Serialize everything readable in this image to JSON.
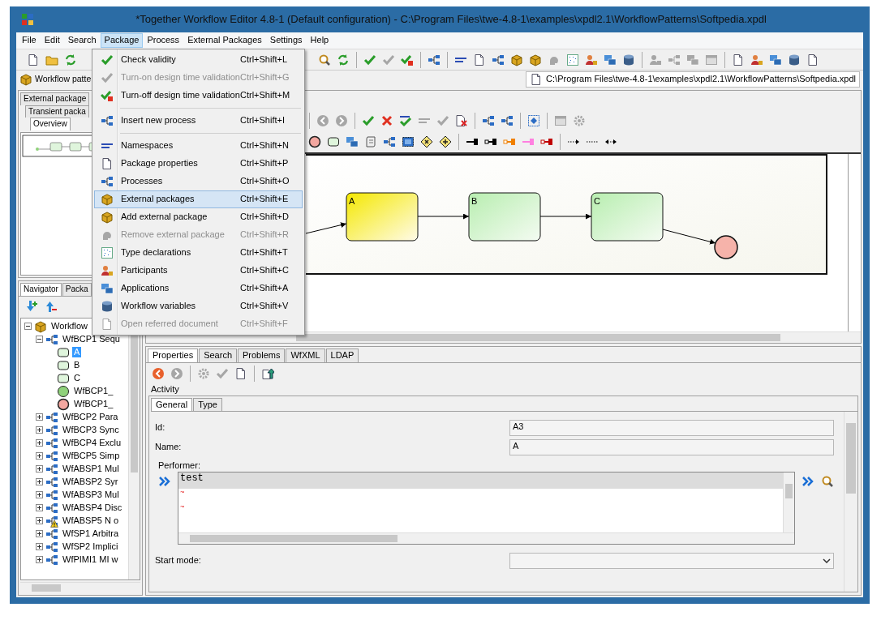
{
  "window": {
    "title": "*Together Workflow Editor 4.8-1 (Default configuration) - C:\\Program Files\\twe-4.8-1\\examples\\xpdl2.1\\WorkflowPatterns\\Softpedia.xpdl"
  },
  "menu_bar": [
    {
      "label": "File",
      "selected": false
    },
    {
      "label": "Edit",
      "selected": false
    },
    {
      "label": "Search",
      "selected": false
    },
    {
      "label": "Package",
      "selected": true
    },
    {
      "label": "Process",
      "selected": false
    },
    {
      "label": "External Packages",
      "selected": false
    },
    {
      "label": "Settings",
      "selected": false
    },
    {
      "label": "Help",
      "selected": false
    }
  ],
  "toolbar": [
    [
      {
        "kind": "doc",
        "disabled": false
      },
      {
        "kind": "folder",
        "disabled": false
      },
      {
        "kind": "sync",
        "disabled": false
      }
    ],
    [
      {
        "kind": "search",
        "disabled": false
      },
      {
        "kind": "sync",
        "disabled": false
      },
      {
        "kind": "separator"
      },
      {
        "kind": "check",
        "disabled": false
      },
      {
        "kind": "check",
        "disabled": true
      },
      {
        "kind": "checkred",
        "disabled": false
      },
      {
        "kind": "separator"
      },
      {
        "kind": "flow",
        "disabled": false
      },
      {
        "kind": "separator"
      },
      {
        "kind": "lines",
        "disabled": false
      },
      {
        "kind": "doc",
        "disabled": false
      },
      {
        "kind": "flow",
        "disabled": false
      },
      {
        "kind": "box",
        "disabled": false
      },
      {
        "kind": "box",
        "disabled": false
      },
      {
        "kind": "head",
        "disabled": true
      },
      {
        "kind": "grid",
        "disabled": false
      },
      {
        "kind": "person",
        "disabled": false
      },
      {
        "kind": "computer",
        "disabled": false
      },
      {
        "kind": "database",
        "disabled": false
      },
      {
        "kind": "separator"
      },
      {
        "kind": "person",
        "disabled": true
      },
      {
        "kind": "flow",
        "disabled": true
      },
      {
        "kind": "computer",
        "disabled": true
      },
      {
        "kind": "window",
        "disabled": true
      },
      {
        "kind": "separator"
      },
      {
        "kind": "doc",
        "disabled": false
      },
      {
        "kind": "person",
        "disabled": false
      },
      {
        "kind": "computer",
        "disabled": false
      },
      {
        "kind": "database",
        "disabled": false
      },
      {
        "kind": "doc",
        "disabled": false
      }
    ]
  ],
  "package_selector": {
    "value": "Workflow patte"
  },
  "file_path": "C:\\Program Files\\twe-4.8-1\\examples\\xpdl2.1\\WorkflowPatterns\\Softpedia.xpdl",
  "left_top_tabs": [
    {
      "label": "External package",
      "selected": false
    },
    {
      "label": "Transient packa",
      "selected": false
    },
    {
      "label": "Overview",
      "selected": true
    }
  ],
  "navigator_tabs": [
    {
      "label": "Navigator",
      "selected": true
    },
    {
      "label": "Packa",
      "selected": false
    }
  ],
  "tree": {
    "label": "Workflow",
    "kind": "package",
    "expanded": true,
    "selected": false,
    "children": [
      {
        "label": "WfBCP1 Sequ",
        "kind": "process",
        "expanded": true,
        "selected": false,
        "warning": false,
        "children": [
          {
            "label": "A",
            "kind": "activity",
            "selected": true
          },
          {
            "label": "B",
            "kind": "activity",
            "selected": false
          },
          {
            "label": "C",
            "kind": "activity",
            "selected": false
          },
          {
            "label": "WfBCP1_",
            "kind": "start",
            "selected": false
          },
          {
            "label": "WfBCP1_",
            "kind": "end",
            "selected": false
          }
        ]
      },
      {
        "label": "WfBCP2 Para",
        "kind": "process",
        "expanded": false,
        "selected": false,
        "warning": false
      },
      {
        "label": "WfBCP3 Sync",
        "kind": "process",
        "expanded": false,
        "selected": false,
        "warning": false
      },
      {
        "label": "WfBCP4 Exclu",
        "kind": "process",
        "expanded": false,
        "selected": false,
        "warning": false
      },
      {
        "label": "WfBCP5 Simp",
        "kind": "process",
        "expanded": false,
        "selected": false,
        "warning": false
      },
      {
        "label": "WfABSP1 Mul",
        "kind": "process",
        "expanded": false,
        "selected": false,
        "warning": false
      },
      {
        "label": "WfABSP2 Syr",
        "kind": "process",
        "expanded": false,
        "selected": false,
        "warning": false
      },
      {
        "label": "WfABSP3 Mul",
        "kind": "process",
        "expanded": false,
        "selected": false,
        "warning": false
      },
      {
        "label": "WfABSP4 Disc",
        "kind": "process",
        "expanded": false,
        "selected": false,
        "warning": false
      },
      {
        "label": "WfABSP5 N o",
        "kind": "process",
        "expanded": false,
        "selected": false,
        "warning": true
      },
      {
        "label": "WfSP1 Arbitra",
        "kind": "process",
        "expanded": false,
        "selected": false,
        "warning": false
      },
      {
        "label": "WfSP2 Implici",
        "kind": "process",
        "expanded": false,
        "selected": false,
        "warning": false
      },
      {
        "label": "WfPIMI1 MI w",
        "kind": "process",
        "expanded": false,
        "selected": false,
        "warning": false
      }
    ]
  },
  "diagram": {
    "toolbar_rows": [
      [
        {
          "kind": "separator"
        },
        {
          "kind": "back",
          "disabled": true
        },
        {
          "kind": "forward",
          "disabled": true
        },
        {
          "kind": "separator"
        },
        {
          "kind": "check",
          "disabled": false
        },
        {
          "kind": "cross",
          "disabled": false
        },
        {
          "kind": "textcheck",
          "disabled": false
        },
        {
          "kind": "lines",
          "disabled": true
        },
        {
          "kind": "check",
          "disabled": true
        },
        {
          "kind": "docx",
          "disabled": false
        },
        {
          "kind": "separator"
        },
        {
          "kind": "flow",
          "disabled": false
        },
        {
          "kind": "flow",
          "disabled": false
        },
        {
          "kind": "separator"
        },
        {
          "kind": "select",
          "disabled": false
        },
        {
          "kind": "separator"
        },
        {
          "kind": "window",
          "disabled": true
        },
        {
          "kind": "gear",
          "disabled": true
        }
      ],
      [
        {
          "kind": "endcircle",
          "disabled": false
        },
        {
          "kind": "roundrect",
          "disabled": false
        },
        {
          "kind": "computer",
          "disabled": false
        },
        {
          "kind": "scroll",
          "disabled": false
        },
        {
          "kind": "flow",
          "disabled": false
        },
        {
          "kind": "subprocess",
          "disabled": false
        },
        {
          "kind": "diamondx",
          "disabled": false
        },
        {
          "kind": "diamondplus",
          "disabled": false
        },
        {
          "kind": "separator"
        },
        {
          "kind": "arrow",
          "disabled": false,
          "color": "#000000"
        },
        {
          "kind": "openarrow",
          "disabled": false,
          "color": "#000000"
        },
        {
          "kind": "openarrow",
          "disabled": false,
          "color": "#f08000"
        },
        {
          "kind": "arrow",
          "disabled": false,
          "color": "#ff80e0"
        },
        {
          "kind": "openarrow",
          "disabled": false,
          "color": "#c00000"
        },
        {
          "kind": "separator"
        },
        {
          "kind": "dotted",
          "disabled": false
        },
        {
          "kind": "dottedline",
          "disabled": false
        },
        {
          "kind": "dottedboth",
          "disabled": false
        }
      ]
    ],
    "nodes": [
      {
        "kind": "activity",
        "label": "A",
        "selected": true
      },
      {
        "kind": "activity",
        "label": "B",
        "selected": false
      },
      {
        "kind": "activity",
        "label": "C",
        "selected": false
      },
      {
        "kind": "end",
        "selected": false
      }
    ]
  },
  "properties": {
    "tabs": [
      {
        "label": "Properties",
        "selected": true
      },
      {
        "label": "Search",
        "selected": false
      },
      {
        "label": "Problems",
        "selected": false
      },
      {
        "label": "WfXML",
        "selected": false
      },
      {
        "label": "LDAP",
        "selected": false
      }
    ],
    "toolbar": [
      {
        "kind": "back",
        "disabled": false
      },
      {
        "kind": "forward",
        "disabled": true
      },
      {
        "kind": "separator"
      },
      {
        "kind": "gear",
        "disabled": true
      },
      {
        "kind": "check",
        "disabled": true
      },
      {
        "kind": "doc",
        "disabled": false
      },
      {
        "kind": "separator"
      },
      {
        "kind": "upload",
        "disabled": false
      }
    ],
    "section": "Activity",
    "inner_tabs": [
      {
        "label": "General",
        "selected": true
      },
      {
        "label": "Type",
        "selected": false
      }
    ],
    "fields": [
      {
        "label": "Id:",
        "value": "A3"
      },
      {
        "label": "Name:",
        "value": "A"
      }
    ],
    "performer": {
      "label": "Performer:",
      "lines": [
        "test",
        "~",
        "~"
      ]
    },
    "start_mode": {
      "label": "Start mode:"
    }
  },
  "package_menu": {
    "groups": [
      [
        {
          "label": "Check validity",
          "shortcut": "Ctrl+Shift+L",
          "kind": "check",
          "disabled": false,
          "selected": false
        },
        {
          "label": "Turn-on design time validation",
          "shortcut": "Ctrl+Shift+G",
          "kind": "check",
          "disabled": true,
          "selected": false
        },
        {
          "label": "Turn-off design time validation",
          "shortcut": "Ctrl+Shift+M",
          "kind": "checkred",
          "disabled": false,
          "selected": false
        }
      ],
      [
        {
          "label": "Insert new process",
          "shortcut": "Ctrl+Shift+I",
          "kind": "flow",
          "disabled": false,
          "selected": false
        }
      ],
      [
        {
          "label": "Namespaces",
          "shortcut": "Ctrl+Shift+N",
          "kind": "lines",
          "disabled": false,
          "selected": false
        },
        {
          "label": "Package properties",
          "shortcut": "Ctrl+Shift+P",
          "kind": "doc",
          "disabled": false,
          "selected": false
        },
        {
          "label": "Processes",
          "shortcut": "Ctrl+Shift+O",
          "kind": "flow",
          "disabled": false,
          "selected": false
        },
        {
          "label": "External packages",
          "shortcut": "Ctrl+Shift+E",
          "kind": "box",
          "disabled": false,
          "selected": true
        },
        {
          "label": "Add external package",
          "shortcut": "Ctrl+Shift+D",
          "kind": "box",
          "disabled": false,
          "selected": false
        },
        {
          "label": "Remove external package",
          "shortcut": "Ctrl+Shift+R",
          "kind": "head",
          "disabled": true,
          "selected": false
        },
        {
          "label": "Type declarations",
          "shortcut": "Ctrl+Shift+T",
          "kind": "grid",
          "disabled": false,
          "selected": false
        },
        {
          "label": "Participants",
          "shortcut": "Ctrl+Shift+C",
          "kind": "person",
          "disabled": false,
          "selected": false
        },
        {
          "label": "Applications",
          "shortcut": "Ctrl+Shift+A",
          "kind": "computer",
          "disabled": false,
          "selected": false
        },
        {
          "label": "Workflow variables",
          "shortcut": "Ctrl+Shift+V",
          "kind": "database",
          "disabled": false,
          "selected": false
        },
        {
          "label": "Open referred document",
          "shortcut": "Ctrl+Shift+F",
          "kind": "doc",
          "disabled": true,
          "selected": false
        }
      ]
    ]
  }
}
